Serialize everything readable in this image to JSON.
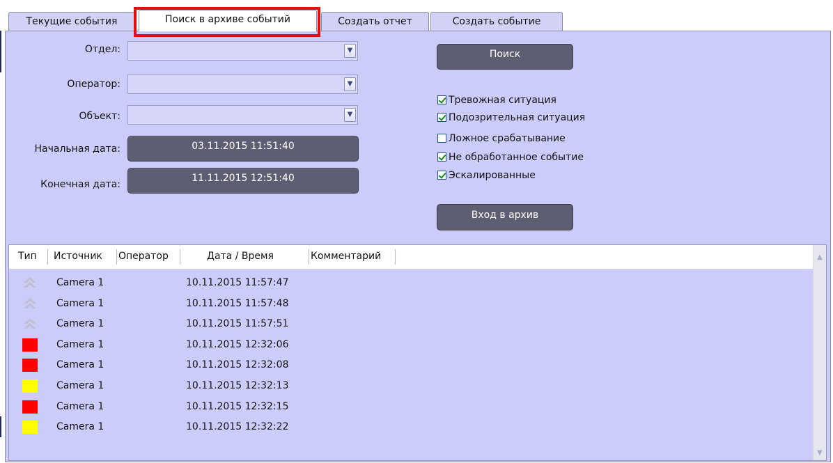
{
  "tabs": [
    {
      "label": "Текущие события"
    },
    {
      "label": "Поиск в архиве событий"
    },
    {
      "label": "Создать отчет"
    },
    {
      "label": "Создать событие"
    }
  ],
  "form": {
    "department_label": "Отдел:",
    "department_value": "",
    "operator_label": "Оператор:",
    "operator_value": "",
    "object_label": "Объект:",
    "object_value": "",
    "start_date_label": "Начальная дата:",
    "start_date_value": "03.11.2015 11:51:40",
    "end_date_label": "Конечная дата:",
    "end_date_value": "11.11.2015 12:51:40"
  },
  "actions": {
    "search_label": "Поиск",
    "archive_label": "Вход в архив"
  },
  "filters": [
    {
      "label": "Тревожная ситуация",
      "checked": true
    },
    {
      "label": "Подозрительная ситуация",
      "checked": true
    },
    {
      "label": "Ложное срабатывание",
      "checked": false
    },
    {
      "label": "Не обработанное событие",
      "checked": true
    },
    {
      "label": "Эскалированные",
      "checked": true
    }
  ],
  "table": {
    "columns": [
      "Тип",
      "Источник",
      "Оператор",
      "Дата / Время",
      "Комментарий"
    ],
    "rows": [
      {
        "type": "arrow-up-icon",
        "source": "Camera 1",
        "operator": "",
        "datetime": "10.11.2015 11:57:47",
        "comment": ""
      },
      {
        "type": "arrow-up-icon",
        "source": "Camera 1",
        "operator": "",
        "datetime": "10.11.2015 11:57:48",
        "comment": ""
      },
      {
        "type": "arrow-up-icon",
        "source": "Camera 1",
        "operator": "",
        "datetime": "10.11.2015 11:57:51",
        "comment": ""
      },
      {
        "type": "red",
        "source": "Camera 1",
        "operator": "",
        "datetime": "10.11.2015 12:32:06",
        "comment": ""
      },
      {
        "type": "red",
        "source": "Camera 1",
        "operator": "",
        "datetime": "10.11.2015 12:32:08",
        "comment": ""
      },
      {
        "type": "yellow",
        "source": "Camera 1",
        "operator": "",
        "datetime": "10.11.2015 12:32:13",
        "comment": ""
      },
      {
        "type": "red",
        "source": "Camera 1",
        "operator": "",
        "datetime": "10.11.2015 12:32:15",
        "comment": ""
      },
      {
        "type": "yellow",
        "source": "Camera 1",
        "operator": "",
        "datetime": "10.11.2015 12:32:22",
        "comment": ""
      }
    ]
  },
  "colors": {
    "panel_bg": "#ccccfb",
    "button_bg": "#5e5e73",
    "highlight": "#e01010",
    "status_red": "#ff0000",
    "status_yellow": "#ffff00"
  }
}
